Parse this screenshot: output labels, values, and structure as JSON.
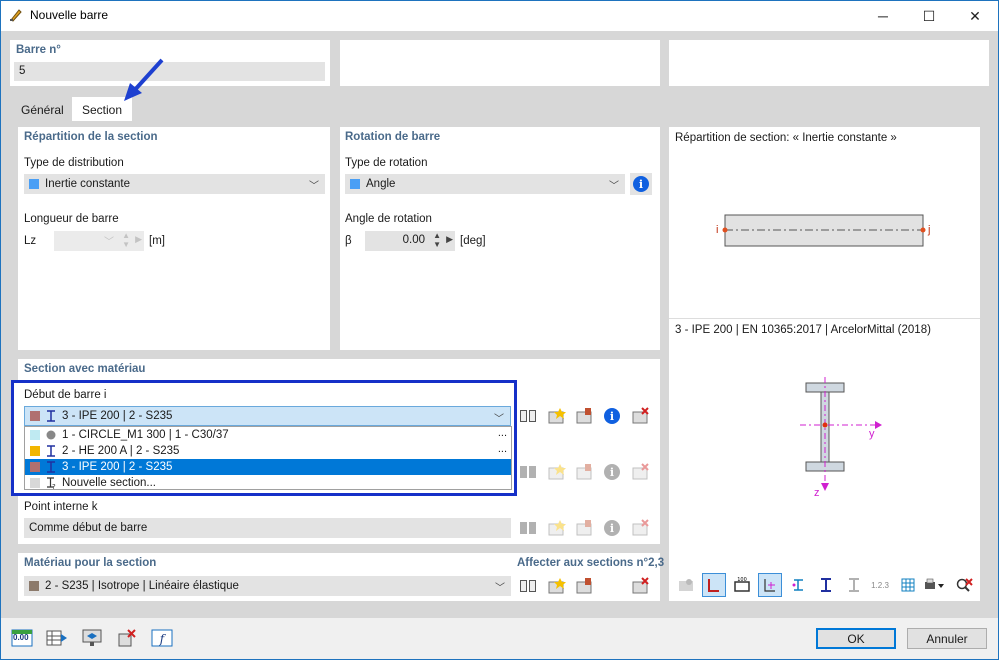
{
  "window": {
    "title": "Nouvelle barre",
    "minimize": "─",
    "maximize": "☐",
    "close": "✕"
  },
  "bar_no": {
    "label": "Barre n°",
    "value": "5"
  },
  "tabs": [
    {
      "label": "Général"
    },
    {
      "label": "Section"
    }
  ],
  "section_distribution": {
    "header": "Répartition de la section",
    "type_label": "Type de distribution",
    "type_value": "Inertie constante",
    "type_color": "#4a9ff5",
    "length_label": "Longueur de barre",
    "length_symbol": "Lz",
    "length_unit": "[m]"
  },
  "rotation": {
    "header": "Rotation de barre",
    "type_label": "Type de rotation",
    "type_value": "Angle",
    "type_color": "#4a9ff5",
    "angle_label": "Angle de rotation",
    "angle_symbol": "β",
    "angle_value": "0.00",
    "angle_unit": "[deg]"
  },
  "section_material": {
    "header": "Section avec matériau",
    "start_label": "Début de barre i",
    "start_value": "3 - IPE 200 | 2 - S235",
    "dropdown_options": [
      {
        "text": "1 - CIRCLE_M1 300 | 1 - C30/37",
        "color": "#bfeaf2",
        "icon": "circle-icon",
        "dots": "..."
      },
      {
        "text": "2 - HE 200 A | 2 - S235",
        "color": "#f2b600",
        "icon": "i-beam-icon",
        "dots": "..."
      },
      {
        "text": "3 - IPE 200 | 2 - S235",
        "color": "#b07070",
        "icon": "i-beam-icon",
        "dots": ""
      },
      {
        "text": "Nouvelle section...",
        "color": "#d8d8d8",
        "icon": "new-section-icon",
        "dots": ""
      }
    ],
    "internal_label": "Point interne k",
    "internal_value": "Comme début de barre"
  },
  "material": {
    "header": "Matériau pour la section",
    "assign_label": "Affecter aux sections n°2,3",
    "value": "2 - S235 | Isotrope | Linéaire élastique",
    "color": "#8c7a6b"
  },
  "preview": {
    "distribution_title": "Répartition de section: « Inertie constante »",
    "node_i": "i",
    "node_j": "j",
    "section_title": "3 - IPE 200 | EN 10365:2017 | ArcelorMittal (2018)",
    "axis_y": "y",
    "axis_z": "z",
    "numbering_label": "1.2.3"
  },
  "footer": {
    "ok": "OK",
    "cancel": "Annuler",
    "units_label": "0.00"
  }
}
